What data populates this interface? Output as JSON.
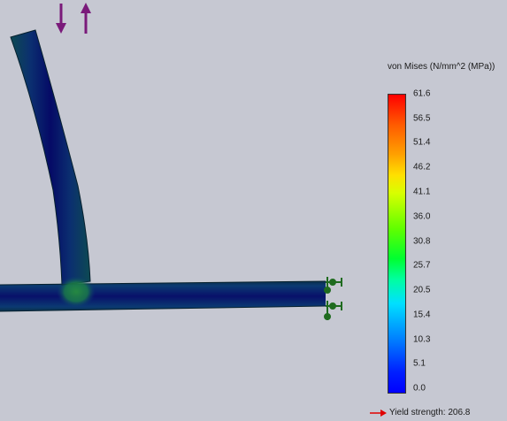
{
  "legend": {
    "title": "von Mises (N/mm^2 (MPa))",
    "ticks": [
      "61.6",
      "56.5",
      "51.4",
      "46.2",
      "41.1",
      "36.0",
      "30.8",
      "25.7",
      "20.5",
      "15.4",
      "10.3",
      "5.1",
      "0.0"
    ],
    "yield_label": "Yield strength: 206.8"
  },
  "colors": {
    "background": "#c6c8d2",
    "arrow": "#7a1a7a",
    "fixture": "#1f6b1f",
    "yield_arrow": "#e00000"
  },
  "icons": {
    "load_arrows": "load-arrow-icon",
    "fixtures": "fixed-geometry-icon"
  }
}
